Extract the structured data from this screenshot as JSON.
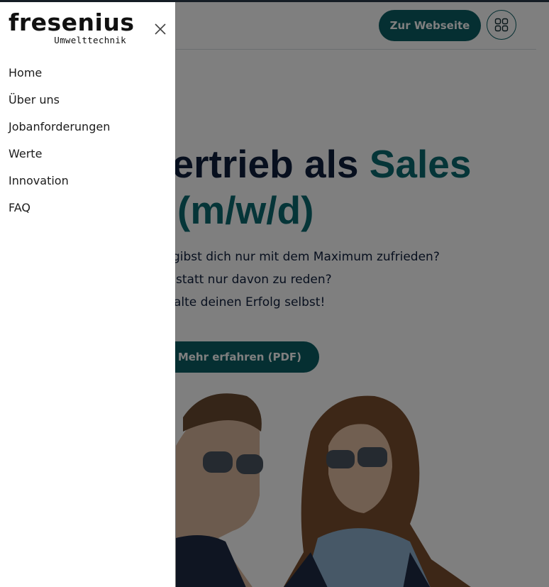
{
  "header": {
    "website_button": "Zur Webseite",
    "apps_icon": "grid-icon"
  },
  "hero": {
    "title_line1_dark": "n Vertrieb als ",
    "title_line1_accent": "Sales",
    "title_line2_accent": "(m/w/d)",
    "lines": [
      "gibst dich nur mit dem Maximum zufrieden?",
      "statt nur davon zu reden?",
      "alte deinen Erfolg selbst!"
    ],
    "pdf_button": "Mehr erfahren (PDF)",
    "pdf_icon": "download-icon"
  },
  "drawer": {
    "logo_word": "fresenius",
    "logo_sub": "Umwelttechnik",
    "close_icon": "close-icon",
    "nav": [
      "Home",
      "Über uns",
      "Jobanforderungen",
      "Werte",
      "Innovation",
      "FAQ"
    ]
  },
  "colors": {
    "brand": "#0b5e64",
    "accent_text": "#0b6b70",
    "heading": "#0f1e3c",
    "overlay": "rgba(0,0,0,0.5)"
  }
}
